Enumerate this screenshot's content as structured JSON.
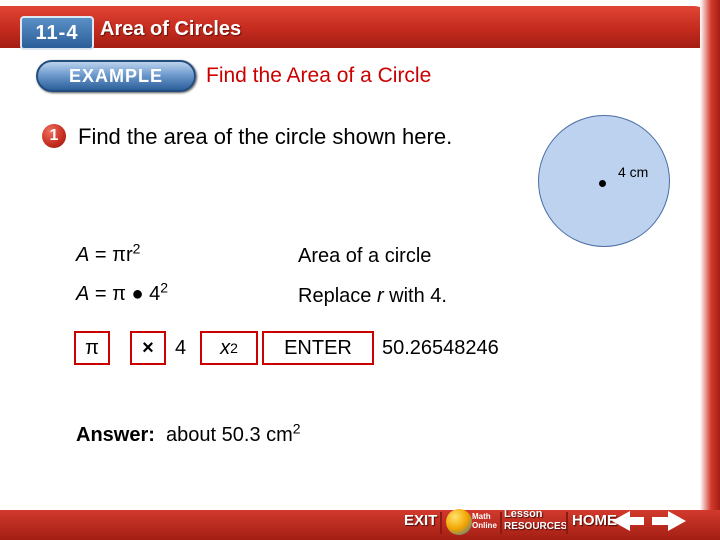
{
  "header": {
    "lesson_number": "11-4",
    "lesson_title": "Area of Circles"
  },
  "example": {
    "pill_label": "EXAMPLE",
    "title": "Find the Area of a Circle"
  },
  "problem": {
    "number": "1",
    "text": "Find the area of the circle shown here."
  },
  "figure": {
    "radius_label": "4 cm",
    "fill_color": "#bcd2ee",
    "stroke_color": "#4a6da5"
  },
  "steps": [
    {
      "lhs": "A",
      "eq": "=",
      "rhs_main": "πr",
      "rhs_exp": "2",
      "note": "Area of a circle"
    },
    {
      "lhs": "A",
      "eq": "=",
      "rhs_main": "π ● 4",
      "rhs_exp": "2",
      "note_prefix": "Replace ",
      "note_var": "r",
      "note_suffix": " with 4."
    }
  ],
  "calculator": {
    "keys": [
      {
        "name": "pi-key",
        "label": "π"
      },
      {
        "name": "multiply-key",
        "label": "×"
      },
      {
        "name": "x-squared-key",
        "label_main": "x",
        "label_exp": "2"
      },
      {
        "name": "enter-key",
        "label": "ENTER"
      }
    ],
    "input_value": "4",
    "result": "50.26548246"
  },
  "answer": {
    "label": "Answer:",
    "text": "about 50.3 cm",
    "exp": "2"
  },
  "nav": {
    "exit": "EXIT",
    "math_online": "Math Online",
    "lesson_resources_top": "Lesson",
    "lesson_resources_bottom": "RESOURCES",
    "home": "HOME",
    "prev": "previous",
    "next": "next"
  },
  "colors": {
    "frame_red": "#c52b1e",
    "title_red": "#cc0000",
    "badge_blue": "#2c5f99"
  }
}
